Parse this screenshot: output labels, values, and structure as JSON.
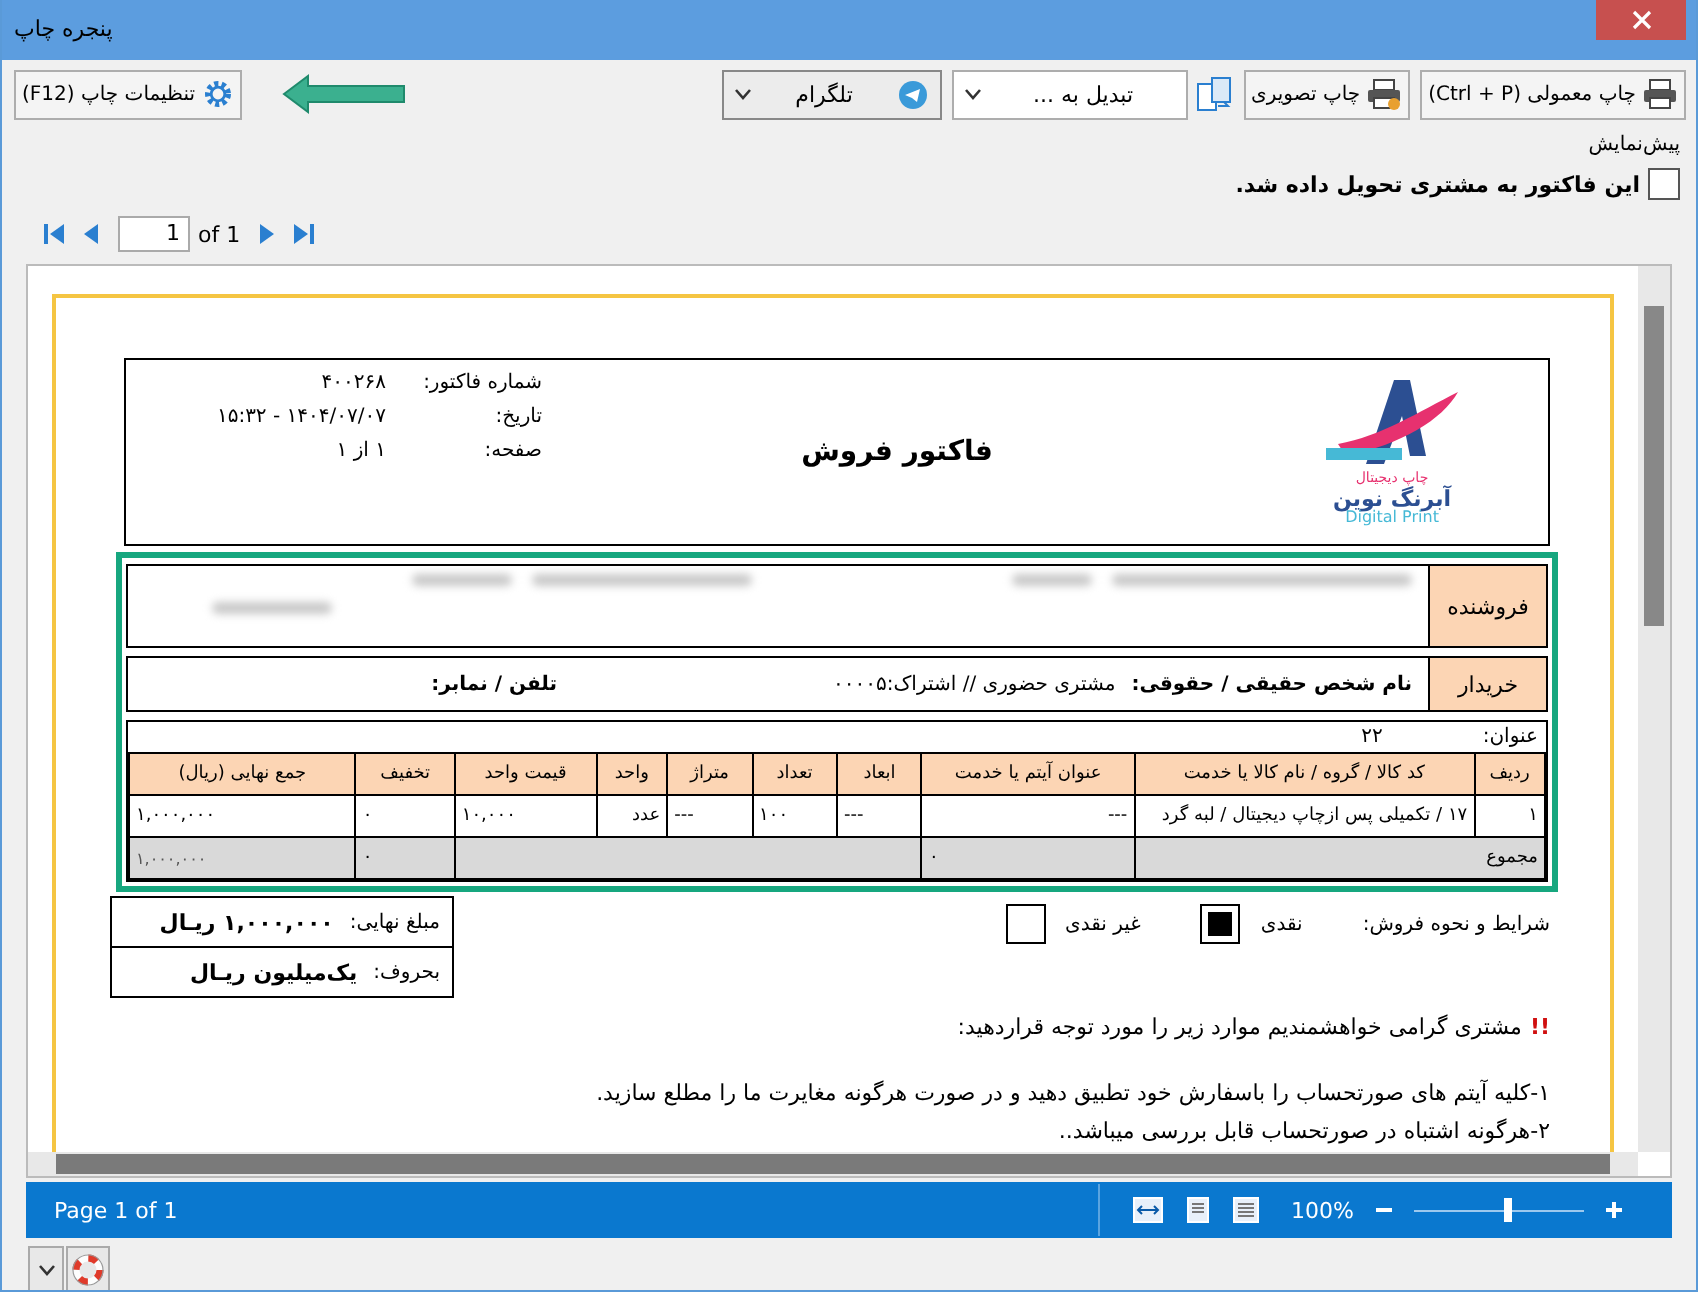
{
  "window": {
    "title": "پنجره چاپ"
  },
  "toolbar": {
    "buttons": [
      {
        "kind": "button",
        "label": "چاپ معمولی (Ctrl + P)"
      },
      {
        "kind": "button",
        "label": "چاپ تصویری"
      },
      {
        "kind": "dropdown",
        "label": "تبدیل به ..."
      },
      {
        "kind": "dropdown",
        "label": "تلگرام"
      }
    ],
    "settings_button": "تنظیمات چاپ (F12)"
  },
  "preview_label": "پیش‌نمایش",
  "delivered_checkbox": {
    "label": "این فاکتور به مشتری تحویل داده شد.",
    "checked": false
  },
  "pager": {
    "page": "1",
    "of": "of 1"
  },
  "invoice": {
    "logo": {
      "tagline": "چاپ دیجیتال",
      "name": "آبرنگ نوین",
      "latin": "Digital Print"
    },
    "title": "فاکتور فروش",
    "info": [
      {
        "label": "شماره فاکتور:",
        "value": "۴۰۰۲۶۸"
      },
      {
        "label": "تاریخ:",
        "value": "۱۴۰۴/۰۷/۰۷ - ۱۵:۳۲"
      },
      {
        "label": "صفحه:",
        "value": "۱ از ۱"
      }
    ],
    "seller_label": "فروشنده",
    "buyer": {
      "label": "خریدار",
      "name_label": "نام شخص حقیقی / حقوقی:",
      "name_value": "مشتری حضوری // اشتراک:۰۰۰۰۵",
      "phone_label": "تلفن / نمابر:"
    },
    "address": {
      "label": "عنوان:",
      "value": "۲۲"
    },
    "table": {
      "columns": [
        "ردیف",
        "کد کالا / گروه / نام کالا یا خدمت",
        "عنوان آیتم یا خدمت",
        "ابعاد",
        "تعداد",
        "متراژ",
        "واحد",
        "قیمت واحد",
        "تخفیف",
        "جمع نهایی (ریال)"
      ],
      "rows": [
        [
          "۱",
          "۱۷ /  تکمیلی پس ازچاپ دیجیتال / لبه گرد",
          "---",
          "---",
          "۱۰۰",
          "---",
          "عدد",
          "۱۰,۰۰۰",
          "۰",
          "۱,۰۰۰,۰۰۰"
        ]
      ],
      "totals": {
        "label": "مجموع",
        "title_total": "۰",
        "discount_total": "۰",
        "grand_total": "۱,۰۰۰,۰۰۰"
      }
    },
    "payment": {
      "label": "شرایط و نحوه فروش:",
      "options": [
        {
          "label": "نقدی",
          "checked": true
        },
        {
          "label": "غیر نقدی",
          "checked": false
        }
      ]
    },
    "amount": {
      "label": "مبلغ نهایی:",
      "value": "۱,۰۰۰,۰۰۰ ریـال",
      "words_label": "بحروف:",
      "words_value": "یک‌میلیون ریـال"
    },
    "notes": {
      "alert_mark": "!!",
      "intro": "مشتری گرامی خواهشمندیم موارد زیر را مورد توجه قراردهید:",
      "items": [
        "۱-کلیه آیتم های صورتحساب را باسفارش خود تطبیق دهید و در صورت هرگونه مغایرت ما را مطلع سازید.",
        "۲-هرگونه اشتباه در صورتحساب قابل بررسی میباشد.."
      ]
    }
  },
  "status_bar": {
    "page": "Page 1 of 1",
    "zoom": "100%",
    "zoom_slider": {
      "level": 0.55
    }
  }
}
